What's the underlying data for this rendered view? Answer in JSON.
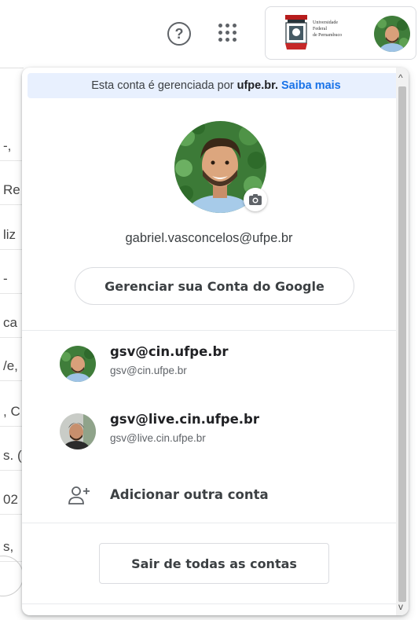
{
  "topbar": {
    "help_icon": "help-circle-icon",
    "apps_icon": "apps-grid-icon",
    "org_logo_lines": [
      "Universidade",
      "Federal",
      "de Pernambuco"
    ]
  },
  "background_page": {
    "fragments": [
      "-,",
      "Re",
      "liz",
      "-",
      "ca",
      "/e,",
      ", C",
      "s. (",
      "02",
      "s,"
    ]
  },
  "popup": {
    "notice": {
      "prefix": "Esta conta é gerenciada por",
      "domain": "ufpe.br.",
      "link": "Saiba mais"
    },
    "primary_email": "gabriel.vasconcelos@ufpe.br",
    "manage_button": "Gerenciar sua Conta do Google",
    "accounts": [
      {
        "name": "gsv@cin.ufpe.br",
        "email": "gsv@cin.ufpe.br"
      },
      {
        "name": "gsv@live.cin.ufpe.br",
        "email": "gsv@live.cin.ufpe.br"
      }
    ],
    "add_account": "Adicionar outra conta",
    "sign_out_all": "Sair de todas as contas"
  },
  "colors": {
    "accent": "#1a73e8",
    "notice_bg": "#e8f0fe",
    "text_primary": "#3c4043",
    "border": "#dadce0"
  }
}
